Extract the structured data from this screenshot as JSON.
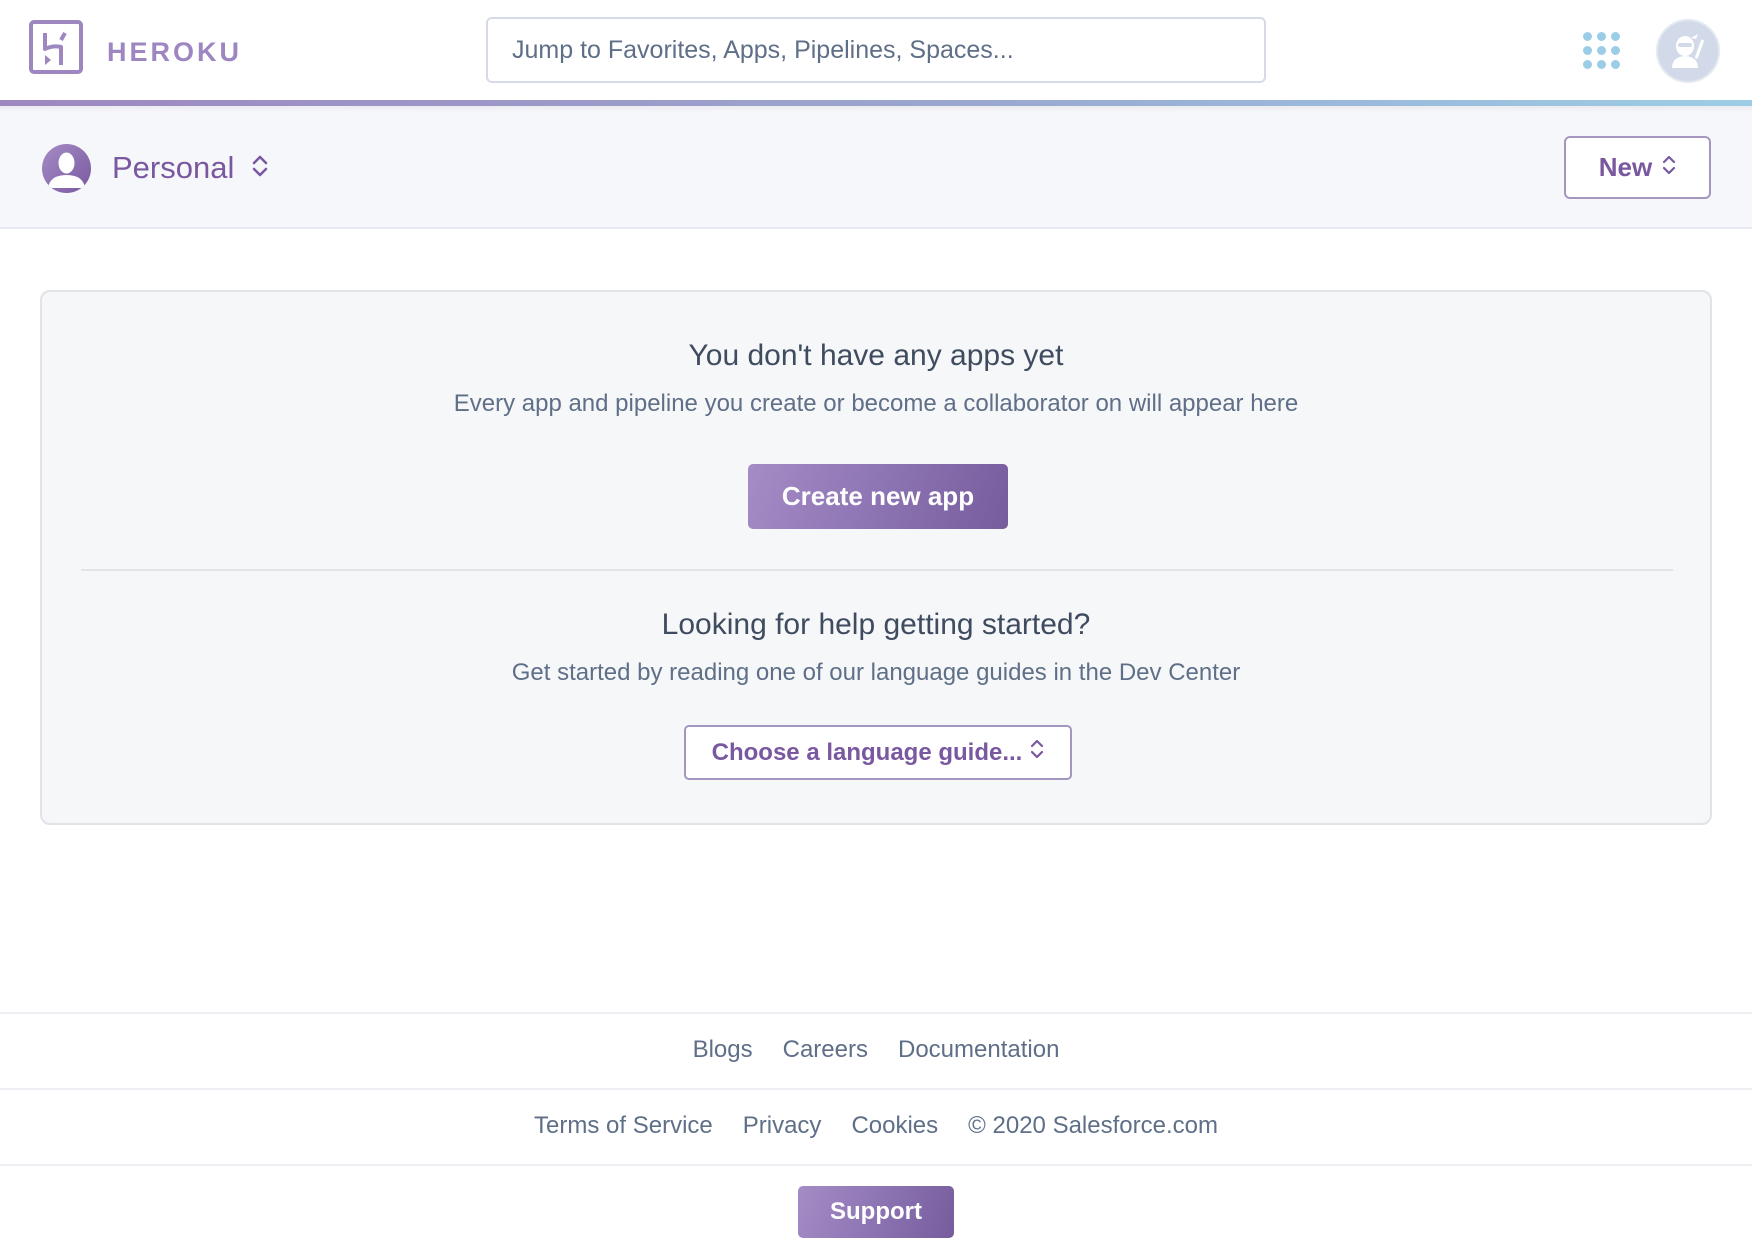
{
  "header": {
    "brand": "HEROKU",
    "search_placeholder": "Jump to Favorites, Apps, Pipelines, Spaces...",
    "search_value": "",
    "apps_menu_icon": "grid-dots-icon",
    "avatar_icon": "ninja-avatar-icon"
  },
  "colors": {
    "brand_purple": "#79589f",
    "logo_purple": "#9e87c0",
    "accent_blue": "#9ccde6",
    "text_muted": "#5f6f88",
    "card_bg": "#f6f7f9"
  },
  "subheader": {
    "context_label": "Personal",
    "context_icon": "user-avatar-icon",
    "new_button_label": "New"
  },
  "empty_state": {
    "title": "You don't have any apps yet",
    "description": "Every app and pipeline you create or become a collaborator on will appear here",
    "create_button_label": "Create new app",
    "help_title": "Looking for help getting started?",
    "help_description": "Get started by reading one of our language guides in the Dev Center",
    "language_select_label": "Choose a language guide..."
  },
  "footer": {
    "links_primary": [
      "Blogs",
      "Careers",
      "Documentation"
    ],
    "links_secondary": [
      "Terms of Service",
      "Privacy",
      "Cookies"
    ],
    "copyright": "© 2020 Salesforce.com",
    "support_label": "Support"
  }
}
